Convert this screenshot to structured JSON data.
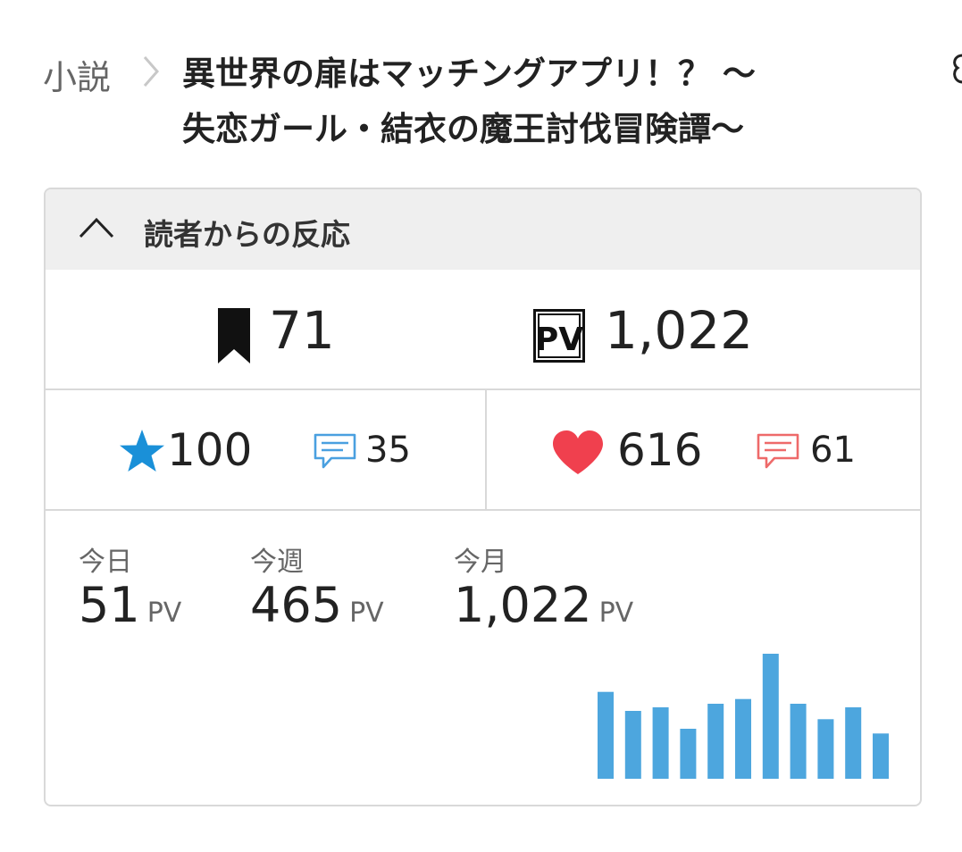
{
  "breadcrumb": {
    "root_label": "小説",
    "title_line1": "異世界の扉はマッチングアプリ！？ 〜",
    "title_line2": "失恋ガール・結衣の魔王討伐冒険譚〜"
  },
  "reactions": {
    "header_title": "読者からの反応",
    "bookmarks": "71",
    "total_pv": "1,022",
    "stars": "100",
    "star_reviews": "35",
    "likes": "616",
    "like_comments": "61"
  },
  "pv": {
    "today_label": "今日",
    "today_value": "51",
    "week_label": "今週",
    "week_value": "465",
    "month_label": "今月",
    "month_value": "1,022",
    "unit": "PV"
  },
  "icons": {
    "bookmark": "bookmark-icon",
    "pv_badge": "pv-badge-icon",
    "star": "star-icon",
    "review": "review-bubble-icon",
    "heart": "heart-icon",
    "comment": "comment-bubble-icon",
    "caret": "chevron-up-icon",
    "separator": "chevron-right-icon"
  },
  "colors": {
    "accent_blue": "#1a90d8",
    "bubble_blue": "#4aa0e0",
    "heart_red": "#f0404e",
    "bubble_red": "#ee6a6a",
    "bar_blue": "#4da6de",
    "header_bg": "#efefef",
    "border": "#d9d9d9"
  },
  "chart_data": {
    "type": "bar",
    "values": [
      73,
      57,
      60,
      42,
      63,
      67,
      105,
      63,
      50,
      60,
      38
    ],
    "ylim": [
      0,
      105
    ]
  }
}
